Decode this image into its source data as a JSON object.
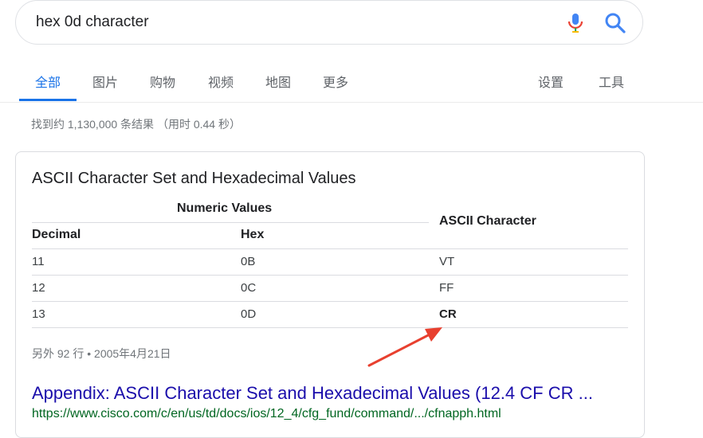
{
  "search": {
    "query": "hex 0d character"
  },
  "tabs": {
    "items": [
      {
        "label": "全部"
      },
      {
        "label": "图片"
      },
      {
        "label": "购物"
      },
      {
        "label": "视频"
      },
      {
        "label": "地图"
      },
      {
        "label": "更多"
      }
    ],
    "settings": "设置",
    "tools": "工具"
  },
  "stats": "找到约 1,130,000 条结果 （用时 0.44 秒）",
  "snippet": {
    "title": "ASCII Character Set and Hexadecimal Values",
    "table": {
      "group_header": "Numeric Values",
      "col_decimal": "Decimal",
      "col_hex": "Hex",
      "col_ascii": "ASCII Character",
      "rows": [
        {
          "decimal": "11",
          "hex": "0B",
          "ascii": "VT"
        },
        {
          "decimal": "12",
          "hex": "0C",
          "ascii": "FF"
        },
        {
          "decimal": "13",
          "hex": "0D",
          "ascii": "CR"
        }
      ]
    },
    "more_rows": "另外 92 行 • 2005年4月21日",
    "result_title": "Appendix: ASCII Character Set and Hexadecimal Values (12.4 CF CR ...",
    "result_url": "https://www.cisco.com/c/en/us/td/docs/ios/12_4/cfg_fund/command/.../cfnapph.html"
  },
  "colors": {
    "accent": "#1a73e8",
    "link": "#1a0dab",
    "url": "#006621",
    "arrow": "#e8402f"
  }
}
